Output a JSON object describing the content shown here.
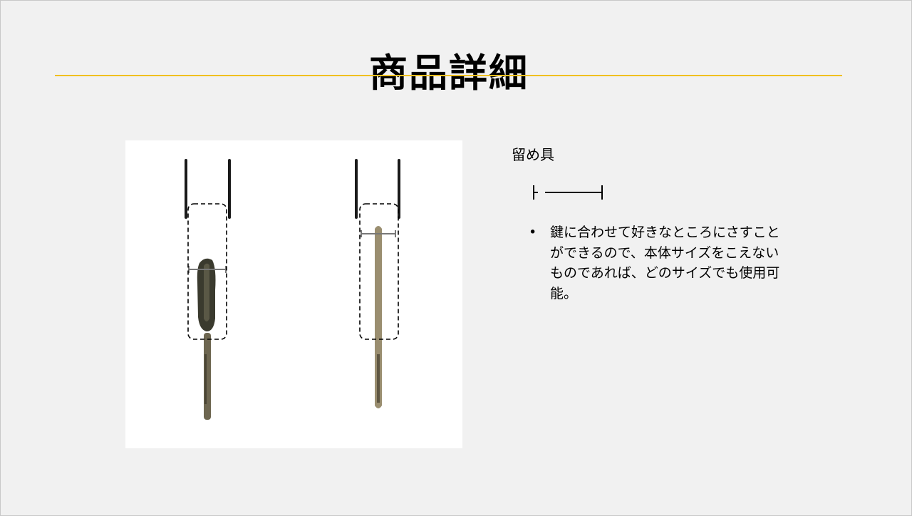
{
  "slide": {
    "title": "商品詳細",
    "accent_color": "#f0c020",
    "background_color": "#f1f1f1"
  },
  "photo": {
    "subject": "key-holder-with-keys"
  },
  "detail": {
    "label": "留め具",
    "fastener_icon": "fastener-bar-icon",
    "bullets": [
      "鍵に合わせて好きなところにさすことができるので、本体サイズをこえないものであれば、どのサイズでも使用可能。"
    ]
  }
}
